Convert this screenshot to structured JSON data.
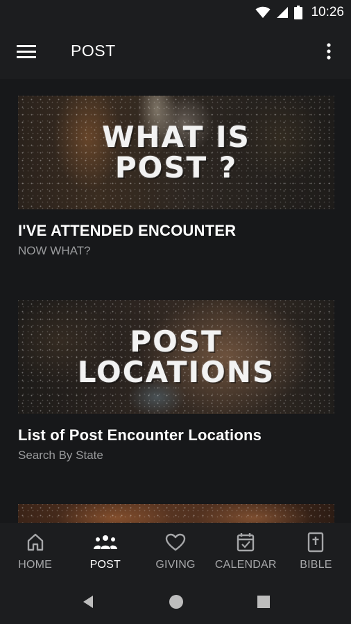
{
  "status_bar": {
    "time": "10:26"
  },
  "app_bar": {
    "title": "POST"
  },
  "cards": [
    {
      "image_text": "WHAT IS\nPOST ?",
      "title": "I'VE ATTENDED ENCOUNTER",
      "subtitle": "NOW WHAT?"
    },
    {
      "image_text": "POST\nLOCATIONS",
      "title": "List of Post Encounter Locations",
      "subtitle": "Search By State"
    }
  ],
  "bottom_nav": {
    "items": [
      {
        "label": "HOME",
        "icon": "home-icon",
        "active": false
      },
      {
        "label": "POST",
        "icon": "group-icon",
        "active": true
      },
      {
        "label": "GIVING",
        "icon": "heart-icon",
        "active": false
      },
      {
        "label": "CALENDAR",
        "icon": "calendar-icon",
        "active": false
      },
      {
        "label": "BIBLE",
        "icon": "bible-icon",
        "active": false
      }
    ]
  },
  "colors": {
    "background": "#17181a",
    "bar": "#1c1d1f",
    "inactive_label": "#a6a7a9",
    "subtitle": "#9a9b9d"
  }
}
